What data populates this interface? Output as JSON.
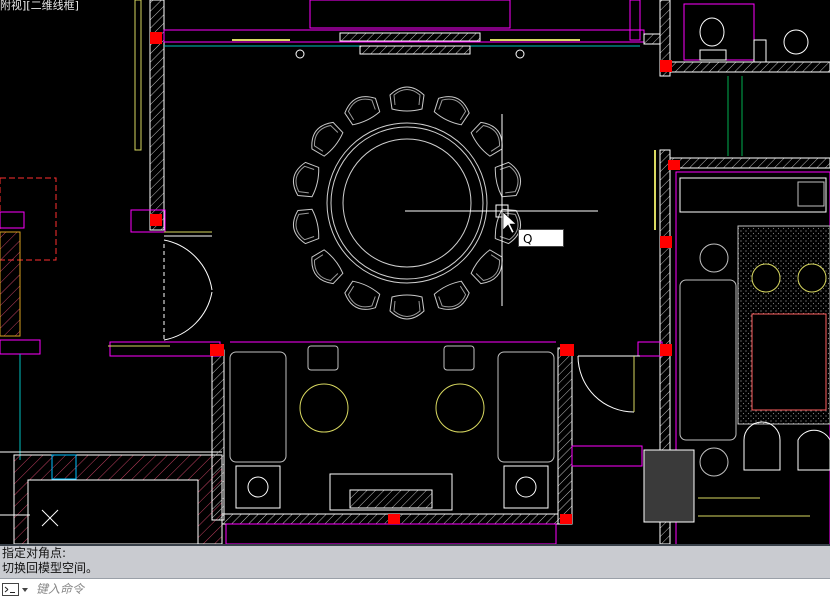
{
  "viewport": {
    "view_label": "附视][二维线框]",
    "dynamic_input_value": "Q"
  },
  "command_history": {
    "line1": "指定对角点:",
    "line2": "切换回模型空间。"
  },
  "command_line": {
    "placeholder": "键入命令",
    "prompt_icon": "command-prompt-icon"
  },
  "colors": {
    "canvas": "#000000",
    "wall": "#ffffff",
    "magenta": "#ff00ff",
    "yellow": "#d8d860",
    "red": "#ff0000",
    "cyan": "#00c0c0",
    "green": "#00b050",
    "furniture": "#c0c0c0"
  }
}
